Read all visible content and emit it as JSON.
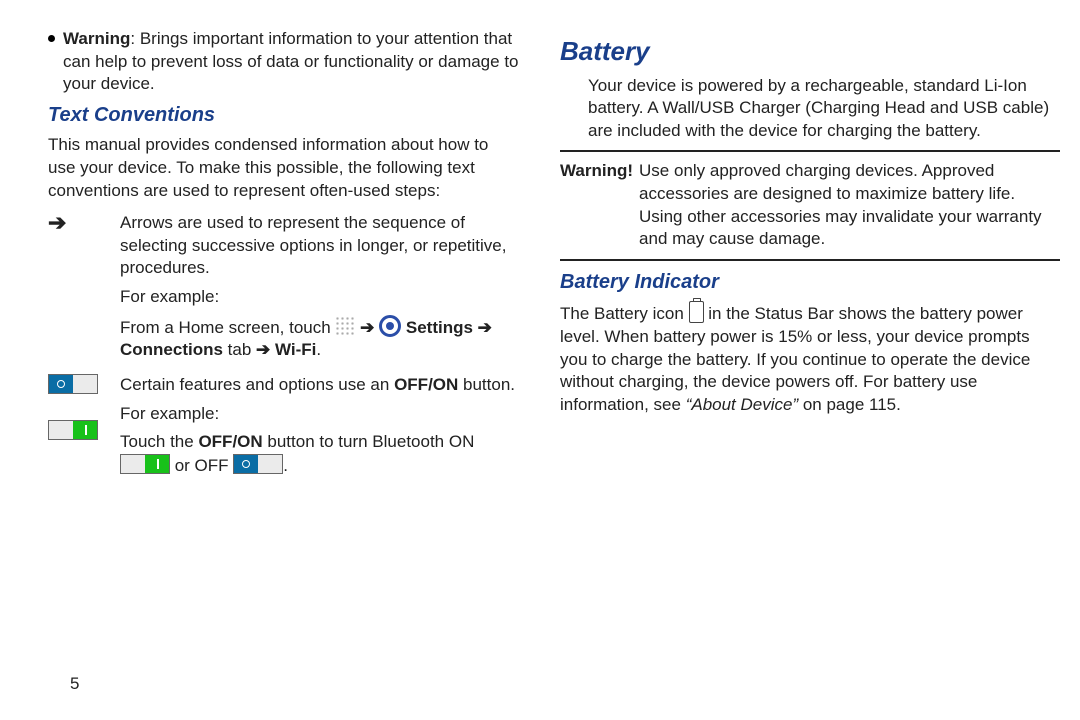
{
  "pageNumber": "5",
  "left": {
    "warningBullet": {
      "label": "Warning",
      "text": ": Brings important information to your attention that can help to prevent loss of data or functionality or damage to your device."
    },
    "textConvHeading": "Text Conventions",
    "textConvIntro": "This manual provides condensed information about how to use your device. To make this possible, the following text conventions are used to represent often-used steps:",
    "arrowSymbol": "➔",
    "arrowRow": {
      "p1": "Arrows are used to represent the sequence of selecting successive options in longer, or repetitive, procedures.",
      "p2": "For example:",
      "p3a": "From a Home screen, touch ",
      "p3settings": "Settings",
      "p3arrow": " ➔ ",
      "p3connections": "Connections",
      "p3b": " tab ",
      "p3wifi": "Wi-Fi",
      "p3dot": "."
    },
    "toggleRow": {
      "p1a": "Certain features and options use an ",
      "p1b": "OFF/ON",
      "p1c": " button.",
      "p2": "For example:",
      "p3a": "Touch the ",
      "p3b": "OFF/ON",
      "p3c": " button to turn Bluetooth ON ",
      "p3d": " or OFF ",
      "p3e": "."
    }
  },
  "right": {
    "batteryHeading": "Battery",
    "batteryPara": "Your device is powered by a rechargeable, standard Li-Ion battery. A Wall/USB Charger (Charging Head and USB cable) are included with the device for charging the battery.",
    "warnLabel": "Warning!",
    "warnText": "Use only approved charging devices. Approved accessories are designed to maximize battery life. Using other accessories may invalidate your warranty and may cause damage.",
    "biHeading": "Battery Indicator",
    "biA": "The Battery icon ",
    "biB": " in the Status Bar shows the battery power level. When battery power is 15% or less, your device prompts you to charge the battery. If you continue to operate the device without charging, the device powers off. For battery use information, see ",
    "biItalic": "“About Device”",
    "biC": " on page 115."
  }
}
